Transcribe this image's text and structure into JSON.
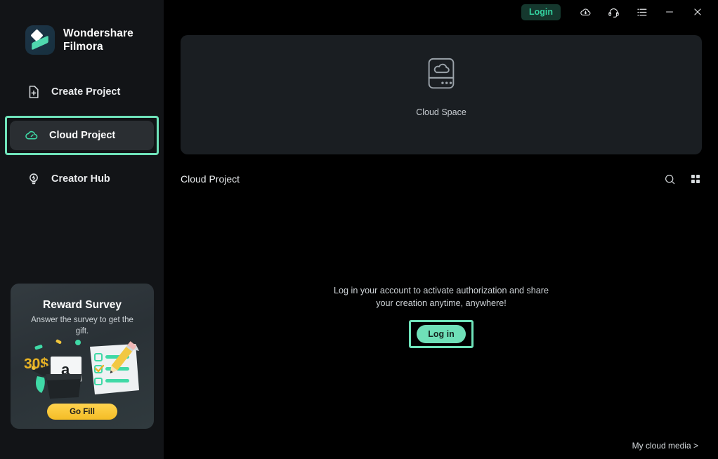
{
  "app": {
    "brand_line1": "Wondershare",
    "brand_line2": "Filmora",
    "logo_icon": "filmora-logo-icon"
  },
  "titlebar": {
    "login_label": "Login",
    "icons": [
      {
        "name": "cloud-download-icon"
      },
      {
        "name": "headset-support-icon"
      },
      {
        "name": "menu-list-icon"
      },
      {
        "name": "minimize-icon"
      },
      {
        "name": "close-icon"
      }
    ]
  },
  "sidebar": {
    "items": [
      {
        "label": "Create Project",
        "icon": "new-document-plus-icon",
        "selected": false
      },
      {
        "label": "Cloud Project",
        "icon": "cloud-icon",
        "selected": true
      },
      {
        "label": "Creator Hub",
        "icon": "lightbulb-idea-icon",
        "selected": false
      }
    ],
    "promo": {
      "title": "Reward Survey",
      "subtitle": "Answer the survey to get the gift.",
      "amount_label": "30$",
      "button_label": "Go Fill",
      "illustration": "gift-box-survey-pencil-illustration"
    }
  },
  "main": {
    "cloud_space": {
      "label": "Cloud Space",
      "icon": "cloud-drive-icon"
    },
    "section": {
      "title": "Cloud Project",
      "search_icon": "search-icon",
      "grid_view_icon": "grid-view-icon"
    },
    "empty_state": {
      "message_line1": "Log in your account to activate authorization and share",
      "message_line2": "your creation anytime, anywhere!",
      "login_button_label": "Log in"
    },
    "footer_link": "My cloud media >"
  },
  "colors": {
    "accent_mint": "#6fe3ba",
    "accent_green_text": "#34d3a0",
    "sidebar_bg": "#121417",
    "main_bg": "#000000",
    "panel_bg": "#1a1e22",
    "promo_button": "#f4bd26"
  }
}
